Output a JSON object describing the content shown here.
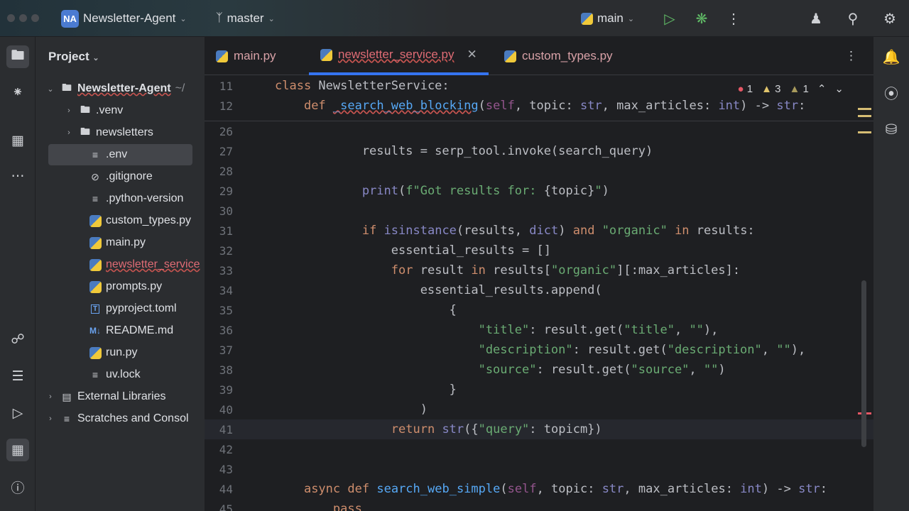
{
  "titlebar": {
    "project_badge": "NA",
    "project_name": "Newsletter-Agent",
    "branch": "master",
    "run_config": "main"
  },
  "sidebar": {
    "title": "Project",
    "items": [
      {
        "label": "Newsletter-Agent",
        "suffix": "~/",
        "type": "root",
        "expanded": true
      },
      {
        "label": ".venv",
        "type": "folder"
      },
      {
        "label": "newsletters",
        "type": "folder"
      },
      {
        "label": ".env",
        "type": "text",
        "selected": true
      },
      {
        "label": ".gitignore",
        "type": "ignore"
      },
      {
        "label": ".python-version",
        "type": "text"
      },
      {
        "label": "custom_types.py",
        "type": "python"
      },
      {
        "label": "main.py",
        "type": "python"
      },
      {
        "label": "newsletter_service",
        "type": "python",
        "error": true
      },
      {
        "label": "prompts.py",
        "type": "python"
      },
      {
        "label": "pyproject.toml",
        "type": "toml"
      },
      {
        "label": "README.md",
        "type": "markdown"
      },
      {
        "label": "run.py",
        "type": "python"
      },
      {
        "label": "uv.lock",
        "type": "text"
      },
      {
        "label": "External Libraries",
        "type": "library"
      },
      {
        "label": "Scratches and Consol",
        "type": "scratch"
      }
    ]
  },
  "tabs": [
    {
      "label": "main.py"
    },
    {
      "label": "newsletter_service.py",
      "active": true
    },
    {
      "label": "custom_types.py"
    }
  ],
  "inspections": {
    "errors": "1",
    "warnings": "3",
    "weak_warnings": "1"
  },
  "colors": {
    "accent": "#3574f0",
    "keyword": "#cf8e6d",
    "string": "#6aab73",
    "function": "#56a8f5"
  },
  "code": [
    {
      "n": "11",
      "sticky": true,
      "t": [
        [
          "kw",
          "class"
        ],
        [
          "def",
          " NewsletterService:"
        ]
      ]
    },
    {
      "n": "12",
      "sticky": true,
      "t": [
        [
          "def",
          "    "
        ],
        [
          "kw",
          "def"
        ],
        [
          "def",
          " "
        ],
        [
          "fnu",
          "_search_web_blocking"
        ],
        [
          "def",
          "("
        ],
        [
          "self",
          "self"
        ],
        [
          "def",
          ", topic: "
        ],
        [
          "type",
          "str"
        ],
        [
          "def",
          ", max_articles: "
        ],
        [
          "type",
          "int"
        ],
        [
          "def",
          ") -> "
        ],
        [
          "type",
          "str"
        ],
        [
          "def",
          ":"
        ]
      ]
    },
    {
      "n": "26",
      "t": []
    },
    {
      "n": "27",
      "t": [
        [
          "def",
          "            results = serp_tool.invoke(search_query)"
        ]
      ]
    },
    {
      "n": "28",
      "t": []
    },
    {
      "n": "29",
      "t": [
        [
          "def",
          "            "
        ],
        [
          "bi",
          "print"
        ],
        [
          "def",
          "("
        ],
        [
          "str",
          "f\"Got results for: "
        ],
        [
          "def",
          "{topic}"
        ],
        [
          "str",
          "\""
        ],
        [
          "def",
          ")"
        ]
      ]
    },
    {
      "n": "30",
      "t": []
    },
    {
      "n": "31",
      "t": [
        [
          "def",
          "            "
        ],
        [
          "kw",
          "if"
        ],
        [
          "def",
          " "
        ],
        [
          "bi",
          "isinstance"
        ],
        [
          "def",
          "(results, "
        ],
        [
          "bi",
          "dict"
        ],
        [
          "def",
          ") "
        ],
        [
          "kw",
          "and"
        ],
        [
          "def",
          " "
        ],
        [
          "str",
          "\"organic\""
        ],
        [
          "def",
          " "
        ],
        [
          "kw",
          "in"
        ],
        [
          "def",
          " results:"
        ]
      ]
    },
    {
      "n": "32",
      "t": [
        [
          "def",
          "                essential_results = []"
        ]
      ]
    },
    {
      "n": "33",
      "t": [
        [
          "def",
          "                "
        ],
        [
          "kw",
          "for"
        ],
        [
          "def",
          " result "
        ],
        [
          "kw",
          "in"
        ],
        [
          "def",
          " results["
        ],
        [
          "str",
          "\"organic\""
        ],
        [
          "def",
          "][:max_articles]:"
        ]
      ]
    },
    {
      "n": "34",
      "t": [
        [
          "def",
          "                    essential_results.append("
        ]
      ]
    },
    {
      "n": "35",
      "t": [
        [
          "def",
          "                        {"
        ]
      ]
    },
    {
      "n": "36",
      "t": [
        [
          "def",
          "                            "
        ],
        [
          "str",
          "\"title\""
        ],
        [
          "def",
          ": result.get("
        ],
        [
          "str",
          "\"title\""
        ],
        [
          "def",
          ", "
        ],
        [
          "str",
          "\"\""
        ],
        [
          "def",
          "),"
        ]
      ]
    },
    {
      "n": "37",
      "t": [
        [
          "def",
          "                            "
        ],
        [
          "str",
          "\"description\""
        ],
        [
          "def",
          ": result.get("
        ],
        [
          "str",
          "\"description\""
        ],
        [
          "def",
          ", "
        ],
        [
          "str",
          "\"\""
        ],
        [
          "def",
          "),"
        ]
      ]
    },
    {
      "n": "38",
      "t": [
        [
          "def",
          "                            "
        ],
        [
          "str",
          "\"source\""
        ],
        [
          "def",
          ": result.get("
        ],
        [
          "str",
          "\"source\""
        ],
        [
          "def",
          ", "
        ],
        [
          "str",
          "\"\""
        ],
        [
          "def",
          ")"
        ]
      ]
    },
    {
      "n": "39",
      "t": [
        [
          "def",
          "                        }"
        ]
      ]
    },
    {
      "n": "40",
      "t": [
        [
          "def",
          "                    )"
        ]
      ]
    },
    {
      "n": "41",
      "current": true,
      "t": [
        [
          "def",
          "                "
        ],
        [
          "kw",
          "return"
        ],
        [
          "def",
          " "
        ],
        [
          "bi",
          "str"
        ],
        [
          "def",
          "({"
        ],
        [
          "str",
          "\"query\""
        ],
        [
          "def",
          ": topicm})"
        ]
      ]
    },
    {
      "n": "42",
      "t": []
    },
    {
      "n": "43",
      "t": []
    },
    {
      "n": "44",
      "t": [
        [
          "def",
          "    "
        ],
        [
          "kw",
          "async"
        ],
        [
          "def",
          " "
        ],
        [
          "kw",
          "def"
        ],
        [
          "def",
          " "
        ],
        [
          "fn",
          "search_web_simple"
        ],
        [
          "def",
          "("
        ],
        [
          "self",
          "self"
        ],
        [
          "def",
          ", topic: "
        ],
        [
          "type",
          "str"
        ],
        [
          "def",
          ", max_articles: "
        ],
        [
          "type",
          "int"
        ],
        [
          "def",
          ") -> "
        ],
        [
          "type",
          "str"
        ],
        [
          "def",
          ":"
        ]
      ]
    },
    {
      "n": "45",
      "t": [
        [
          "kw",
          "        pass"
        ]
      ]
    }
  ]
}
